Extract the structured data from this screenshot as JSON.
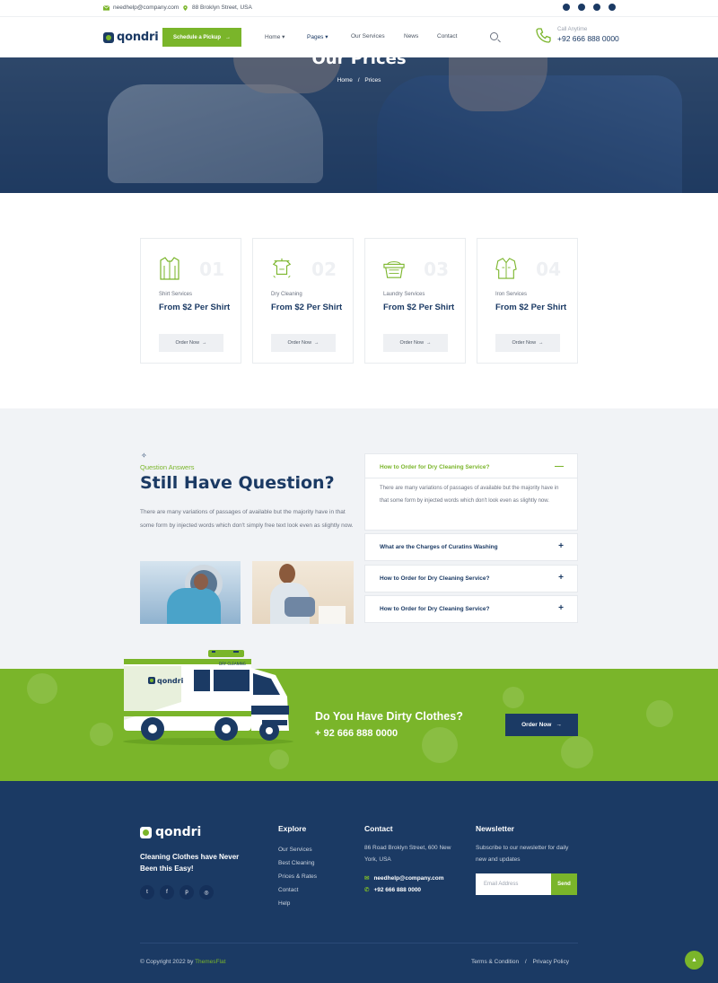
{
  "topbar": {
    "email": "needhelp@company.com",
    "address": "88 Broklyn Street, USA",
    "social": [
      "facebook-icon",
      "twitter-icon",
      "pinterest-icon",
      "instagram-icon"
    ]
  },
  "header": {
    "logo": "qondri",
    "cta": "Schedule a Pickup",
    "nav": [
      "Home",
      "Pages",
      "Our Services",
      "News",
      "Contact"
    ],
    "call_label": "Call Anytime",
    "call_number": "+92 666 888 0000"
  },
  "hero": {
    "title": "Our Prices",
    "crumb_home": "Home",
    "crumb_sep": "/",
    "crumb_current": "Prices"
  },
  "prices": [
    {
      "num": "01",
      "category": "Shirt Services",
      "price": "From $2 Per Shirt",
      "button": "Order Now",
      "icon": "shirt-icon"
    },
    {
      "num": "02",
      "category": "Dry Cleaning",
      "price": "From $2 Per Shirt",
      "button": "Order Now",
      "icon": "dry-cleaning-icon"
    },
    {
      "num": "03",
      "category": "Laundry Services",
      "price": "From $2 Per Shirt",
      "button": "Order Now",
      "icon": "laundry-basket-icon"
    },
    {
      "num": "04",
      "category": "Iron Services",
      "price": "From $2 Per Shirt",
      "button": "Order Now",
      "icon": "jacket-icon"
    }
  ],
  "faq": {
    "subtitle": "Question Answers",
    "title": "Still Have Question?",
    "text": "There are many variations of passages of available but the majority have in that some form by injected words which don't simply free text look even as slightly now.",
    "items": [
      {
        "q": "How to Order for Dry Cleaning Service?",
        "a": "There are many variations of passages of available but the majority have in that some form by injected words which don't look even as slightly now.",
        "open": true,
        "sign": "—"
      },
      {
        "q": "What are the Charges of Curatins Washing",
        "sign": "+"
      },
      {
        "q": "How to Order for Dry Cleaning Service?",
        "sign": "+"
      },
      {
        "q": "How to Order for Dry Cleaning Service?",
        "sign": "+"
      }
    ]
  },
  "cta": {
    "title": "Do You Have Dirty Clothes?",
    "phone": "+ 92 666 888 0000",
    "button": "Order Now",
    "van_logo": "qondri",
    "van_sign": "DRY CLEANING"
  },
  "footer": {
    "logo": "qondri",
    "tagline": "Cleaning Clothes have Never Been this Easy!",
    "social": [
      "twitter-icon",
      "facebook-icon",
      "pinterest-icon",
      "instagram-icon"
    ],
    "explore_title": "Explore",
    "explore": [
      "Our Services",
      "Best Cleaning",
      "Prices & Rates",
      "Contact",
      "Help"
    ],
    "contact_title": "Contact",
    "address": "86 Road Broklyn Street, 600 New York, USA",
    "email": "needhelp@company.com",
    "phone": "+92 666 888 0000",
    "newsletter_title": "Newsletter",
    "newsletter_text": "Subscribe to our newsletter for daily new and updates",
    "email_placeholder": "Email Address",
    "send": "Send",
    "copyright": "© Copyright 2022 by",
    "copyright_brand": "ThemesFlat",
    "terms": "Terms & Condition",
    "terms_sep": "/",
    "privacy": "Privacy Policy"
  },
  "colors": {
    "navy": "#1b3a64",
    "green": "#7ab52a",
    "light": "#f1f3f6"
  }
}
